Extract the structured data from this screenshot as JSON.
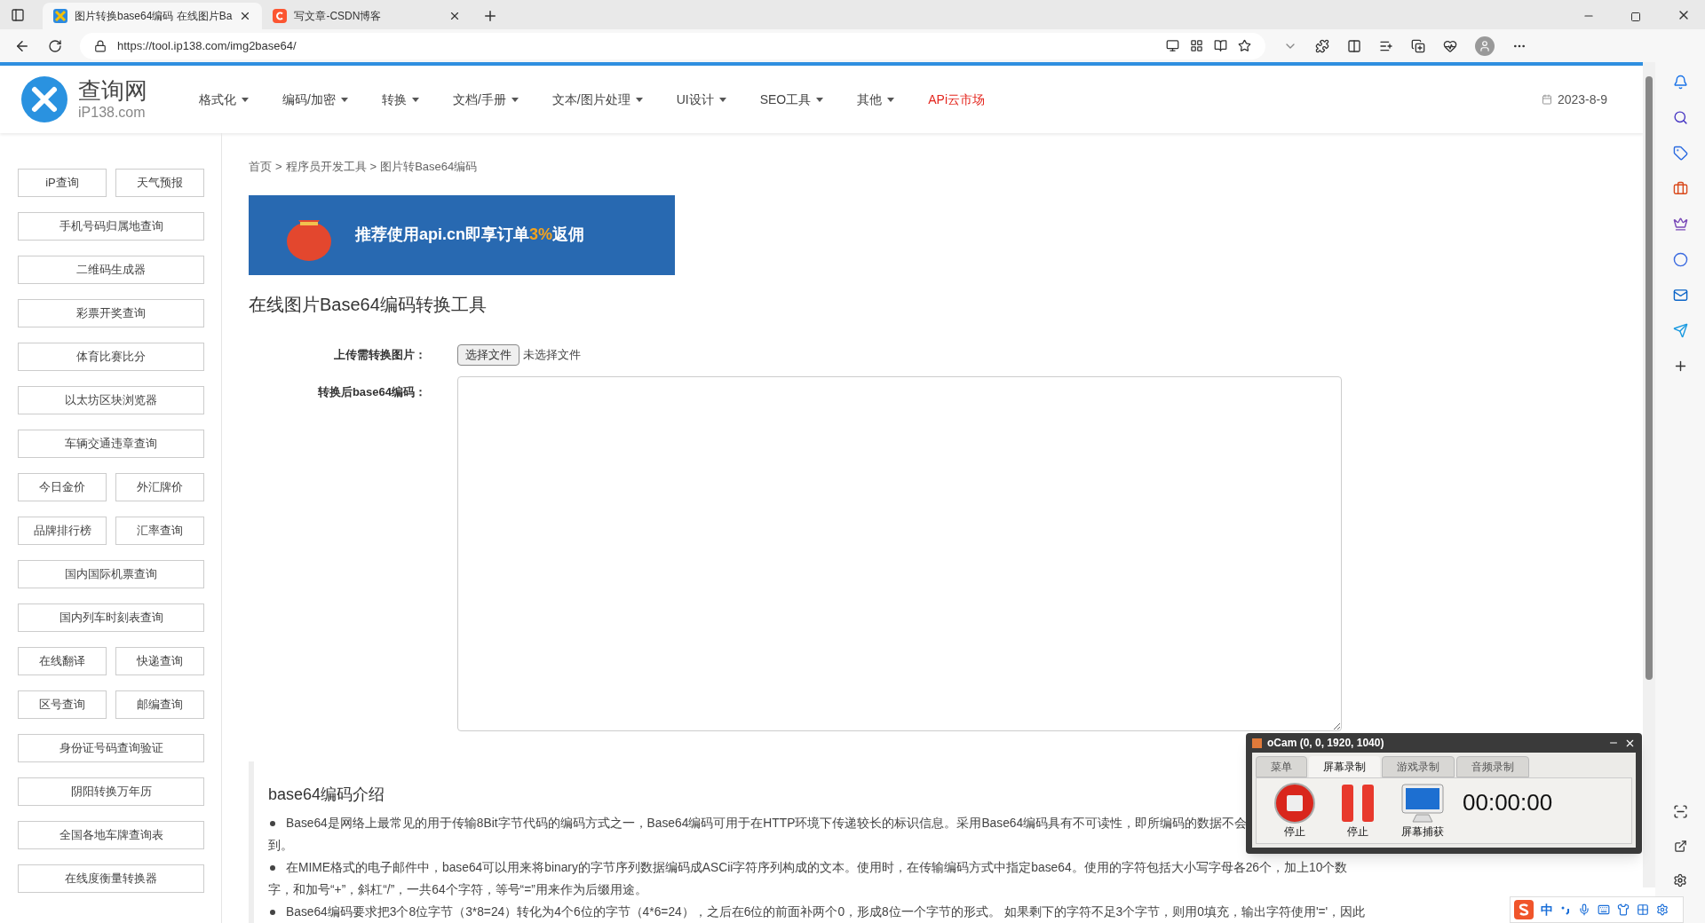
{
  "browser": {
    "tabs": [
      {
        "title": "图片转换base64编码 在线图片Ba",
        "selected": true,
        "kind": "tool"
      },
      {
        "title": "写文章-CSDN博客",
        "selected": false,
        "kind": "csdn"
      }
    ],
    "url": "https://tool.ip138.com/img2base64/"
  },
  "header": {
    "logo_title": "查询网",
    "logo_sub": "iP138.com",
    "nav": [
      {
        "label": "格式化",
        "kind": "dropdown"
      },
      {
        "label": "编码/加密",
        "kind": "dropdown"
      },
      {
        "label": "转换",
        "kind": "dropdown"
      },
      {
        "label": "文档/手册",
        "kind": "dropdown"
      },
      {
        "label": "文本/图片处理",
        "kind": "dropdown"
      },
      {
        "label": "UI设计",
        "kind": "dropdown"
      },
      {
        "label": "SEO工具",
        "kind": "dropdown"
      },
      {
        "label": "其他",
        "kind": "dropdown"
      },
      {
        "label": "APi云市场",
        "kind": "link"
      }
    ],
    "date": "2023-8-9"
  },
  "sidebar": {
    "rows": [
      {
        "items": [
          "iP查询",
          "天气预报"
        ]
      },
      {
        "items": [
          "手机号码归属地查询"
        ]
      },
      {
        "items": [
          "二维码生成器"
        ]
      },
      {
        "items": [
          "彩票开奖查询"
        ]
      },
      {
        "items": [
          "体育比赛比分"
        ]
      },
      {
        "items": [
          "以太坊区块浏览器"
        ]
      },
      {
        "items": [
          "车辆交通违章查询"
        ]
      },
      {
        "items": [
          "今日金价",
          "外汇牌价"
        ]
      },
      {
        "items": [
          "品牌排行榜",
          "汇率查询"
        ]
      },
      {
        "items": [
          "国内国际机票查询"
        ]
      },
      {
        "items": [
          "国内列车时刻表查询"
        ]
      },
      {
        "items": [
          "在线翻译",
          "快递查询"
        ]
      },
      {
        "items": [
          "区号查询",
          "邮编查询"
        ]
      },
      {
        "items": [
          "身份证号码查询验证"
        ]
      },
      {
        "items": [
          "阴阳转换万年历"
        ]
      },
      {
        "items": [
          "全国各地车牌查询表"
        ]
      },
      {
        "items": [
          "在线度衡量转换器"
        ]
      }
    ]
  },
  "breadcrumb": {
    "separator": ">",
    "items": [
      "首页",
      "程序员开发工具",
      "图片转Base64编码"
    ]
  },
  "banner": {
    "text": "推荐使用api.cn即享订单",
    "highlight": "3%",
    "tail": "返佣"
  },
  "title": "在线图片Base64编码转换工具",
  "form": {
    "upload_label": "上传需转换图片：",
    "choose_button": "选择文件",
    "no_file": "未选择文件",
    "output_label": "转换后base64编码："
  },
  "intro": {
    "heading": "base64编码介绍",
    "bullets": [
      {
        "lines": [
          "Base64是网络上最常见的用于传输8Bit字节代码的编码方式之一，Base64编码可用于在HTTP环境下传递较长的标识信息。采用Base64编码具有不可读性，即所编码的数据不会",
          "到。"
        ]
      },
      {
        "lines": [
          "在MIME格式的电子邮件中，base64可以用来将binary的字节序列数据编码成ASCii字符序列构成的文本。使用时，在传输编码方式中指定base64。使用的字符包括大小写字母各26个，加上10个数",
          "字，和加号“+”，斜杠“/”，一共64个字符，等号“=”用来作为后缀用途。"
        ]
      },
      {
        "lines": [
          "Base64编码要求把3个8位字节（3*8=24）转化为4个6位的字节（4*6=24），之后在6位的前面补两个0，形成8位一个字节的形式。 如果剩下的字符不足3个字节，则用0填充，输出字符使用'='，因此"
        ]
      }
    ]
  },
  "ocam": {
    "title": "oCam (0, 0, 1920, 1040)",
    "tabs": [
      {
        "label": "菜单",
        "selected": false
      },
      {
        "label": "屏幕录制",
        "selected": true
      },
      {
        "label": "游戏录制",
        "selected": false
      },
      {
        "label": "音频录制",
        "selected": false
      }
    ],
    "buttons": [
      {
        "label": "停止",
        "kind": "stop"
      },
      {
        "label": "停止",
        "kind": "pause"
      },
      {
        "label": "屏幕捕获",
        "kind": "capture"
      }
    ],
    "timer": "00:00:00"
  },
  "ime": {
    "mode": "中"
  }
}
